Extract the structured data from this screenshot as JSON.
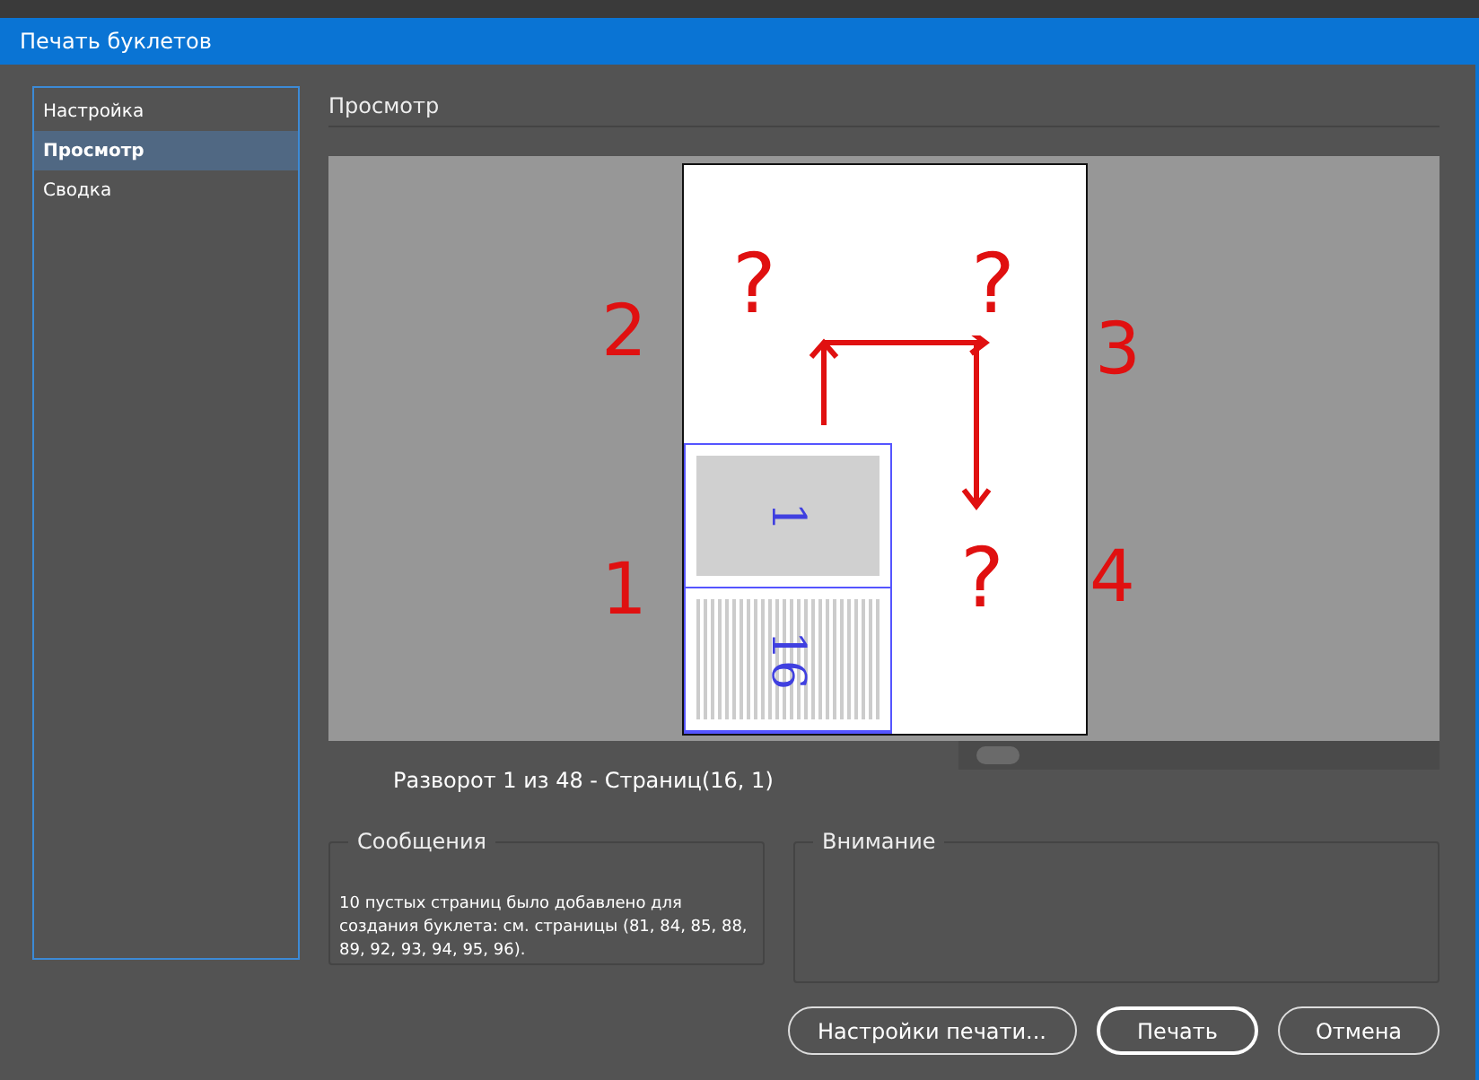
{
  "window": {
    "title": "Печать буклетов"
  },
  "sidebar": {
    "items": [
      {
        "label": "Настройка",
        "selected": false
      },
      {
        "label": "Просмотр",
        "selected": true
      },
      {
        "label": "Сводка",
        "selected": false
      }
    ]
  },
  "section_title": "Просмотр",
  "preview": {
    "page_numbers": [
      "1",
      "16"
    ],
    "annotations": [
      {
        "kind": "question",
        "label": "?"
      },
      {
        "kind": "question",
        "label": "?"
      },
      {
        "kind": "number",
        "label": "2"
      },
      {
        "kind": "number",
        "label": "3"
      },
      {
        "kind": "number",
        "label": "1"
      },
      {
        "kind": "question",
        "label": "?"
      },
      {
        "kind": "number",
        "label": "4"
      }
    ]
  },
  "spread_label": "Разворот 1 из 48 - Страниц(16, 1)",
  "messages": {
    "title": "Сообщения",
    "text": "10 пустых страниц было добавлено для создания буклета: см. страницы (81, 84, 85, 88, 89, 92, 93, 94, 95, 96)."
  },
  "warnings": {
    "title": "Внимание"
  },
  "buttons": [
    {
      "label": "Настройки печати...",
      "selected": false
    },
    {
      "label": "Печать",
      "selected": true
    },
    {
      "label": "Отмена",
      "selected": false
    }
  ]
}
